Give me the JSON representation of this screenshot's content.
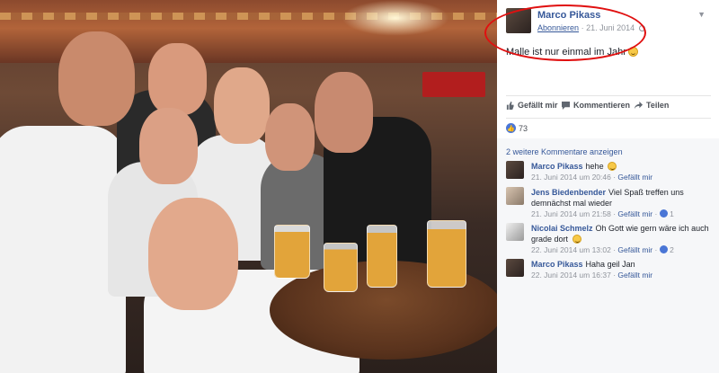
{
  "post": {
    "author": "Marco Pikass",
    "follow": "Abonnieren",
    "date": "21. Juni 2014",
    "text": "Malle ist nur einmal im Jahr",
    "options_icon": "chevron-down-icon"
  },
  "actions": {
    "like": "Gefällt mir",
    "comment": "Kommentieren",
    "share": "Teilen"
  },
  "likes": {
    "count": "73"
  },
  "comments_section": {
    "more_label": "2 weitere Kommentare anzeigen",
    "items": [
      {
        "name": "Marco Pikass",
        "text": "hehe",
        "date": "21. Juni 2014 um 20:46",
        "like": "Gefällt mir",
        "likes": ""
      },
      {
        "name": "Jens Biedenbender",
        "text": "Viel Spaß treffen uns demnächst mal wieder",
        "date": "21. Juni 2014 um 21:58",
        "like": "Gefällt mir",
        "likes": "1"
      },
      {
        "name": "Nicolai Schmelz",
        "text": "Oh Gott wie gern wäre ich auch grade dort",
        "date": "22. Juni 2014 um 13:02",
        "like": "Gefällt mir",
        "likes": "2"
      },
      {
        "name": "Marco Pikass",
        "text": "Haha geil Jan",
        "date": "22. Juni 2014 um 16:37",
        "like": "Gefällt mir",
        "likes": ""
      }
    ]
  },
  "colors": {
    "link": "#365899",
    "highlight": "#e01010",
    "panel": "#f6f7f9",
    "like_badge": "#4a76d6"
  }
}
